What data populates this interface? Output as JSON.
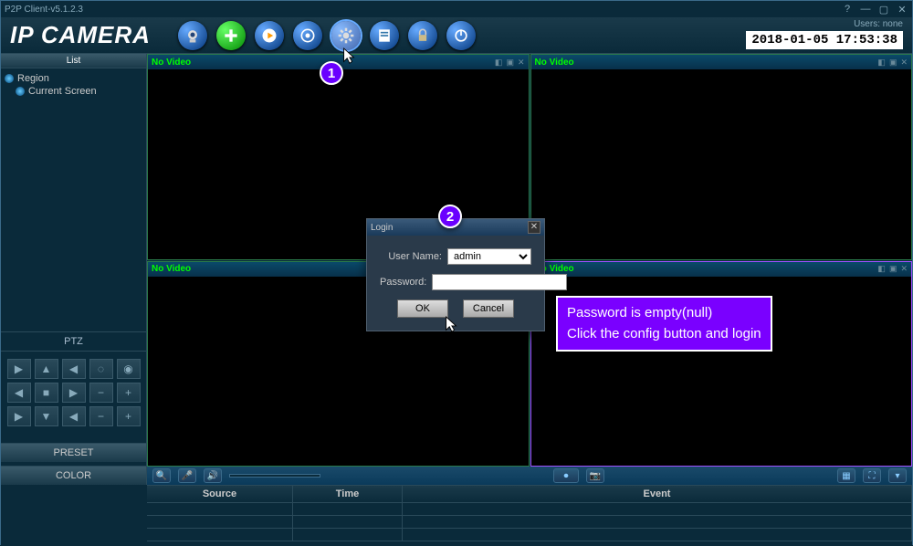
{
  "titlebar": {
    "title": "P2P Client-v5.1.2.3"
  },
  "header": {
    "logo": "IP CAMERA",
    "users_label": "Users: none",
    "clock": "2018-01-05 17:53:38",
    "tools": {
      "camera": "camera-icon",
      "add": "plus-icon",
      "play": "play-icon",
      "target": "target-icon",
      "settings": "gear-icon",
      "log": "log-icon",
      "lock": "lock-icon",
      "power": "power-icon"
    }
  },
  "sidebar": {
    "list_label": "List",
    "items": [
      {
        "label": "Region"
      },
      {
        "label": "Current Screen"
      }
    ],
    "ptz_label": "PTZ",
    "preset_label": "PRESET",
    "color_label": "COLOR"
  },
  "panes": {
    "no_video_label": "No Video"
  },
  "table": {
    "cols": {
      "source": "Source",
      "time": "Time",
      "event": "Event"
    }
  },
  "dialog": {
    "title": "Login",
    "username_label": "User Name:",
    "username_value": "admin",
    "password_label": "Password:",
    "password_value": "",
    "ok": "OK",
    "cancel": "Cancel"
  },
  "annotations": {
    "marker1": "1",
    "marker2": "2",
    "note_line1": "Password is empty(null)",
    "note_line2": "Click the config button and login"
  }
}
